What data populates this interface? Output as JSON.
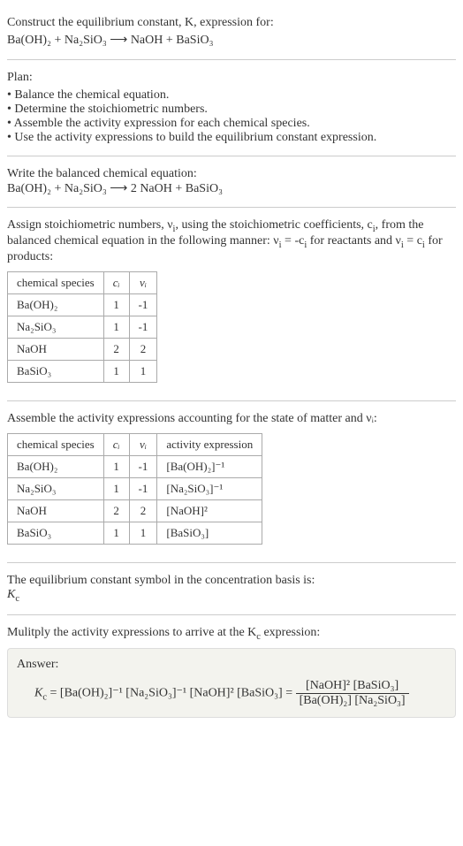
{
  "prompt": {
    "line1": "Construct the equilibrium constant, K, expression for:",
    "equation": "Ba(OH)₂ + Na₂SiO₃ ⟶ NaOH + BaSiO₃"
  },
  "plan": {
    "header": "Plan:",
    "steps": [
      "• Balance the chemical equation.",
      "• Determine the stoichiometric numbers.",
      "• Assemble the activity expression for each chemical species.",
      "• Use the activity expressions to build the equilibrium constant expression."
    ]
  },
  "balanced": {
    "header": "Write the balanced chemical equation:",
    "equation": "Ba(OH)₂ + Na₂SiO₃ ⟶ 2 NaOH + BaSiO₃"
  },
  "stoich": {
    "intro_pre": "Assign stoichiometric numbers, ν",
    "intro_sub1": "i",
    "intro_mid1": ", using the stoichiometric coefficients, c",
    "intro_sub2": "i",
    "intro_mid2": ", from the balanced chemical equation in the following manner: ν",
    "intro_sub3": "i",
    "intro_mid3": " = -c",
    "intro_sub4": "i",
    "intro_mid4": " for reactants and ν",
    "intro_sub5": "i",
    "intro_mid5": " = c",
    "intro_sub6": "i",
    "intro_post": " for products:",
    "headers": [
      "chemical species",
      "cᵢ",
      "νᵢ"
    ],
    "rows": [
      [
        "Ba(OH)₂",
        "1",
        "-1"
      ],
      [
        "Na₂SiO₃",
        "1",
        "-1"
      ],
      [
        "NaOH",
        "2",
        "2"
      ],
      [
        "BaSiO₃",
        "1",
        "1"
      ]
    ]
  },
  "activity": {
    "intro": "Assemble the activity expressions accounting for the state of matter and νᵢ:",
    "headers": [
      "chemical species",
      "cᵢ",
      "νᵢ",
      "activity expression"
    ],
    "rows": [
      [
        "Ba(OH)₂",
        "1",
        "-1",
        "[Ba(OH)₂]⁻¹"
      ],
      [
        "Na₂SiO₃",
        "1",
        "-1",
        "[Na₂SiO₃]⁻¹"
      ],
      [
        "NaOH",
        "2",
        "2",
        "[NaOH]²"
      ],
      [
        "BaSiO₃",
        "1",
        "1",
        "[BaSiO₃]"
      ]
    ]
  },
  "symbol": {
    "line1": "The equilibrium constant symbol in the concentration basis is:",
    "line2": "K",
    "line2sub": "c"
  },
  "multiply": {
    "intro_pre": "Mulitply the activity expressions to arrive at the K",
    "intro_sub": "c",
    "intro_post": " expression:"
  },
  "answer": {
    "label": "Answer:",
    "kc": "K",
    "kcsub": "c",
    "eq": " = [Ba(OH)₂]⁻¹ [Na₂SiO₃]⁻¹ [NaOH]² [BaSiO₃] = ",
    "num": "[NaOH]² [BaSiO₃]",
    "den": "[Ba(OH)₂] [Na₂SiO₃]"
  }
}
